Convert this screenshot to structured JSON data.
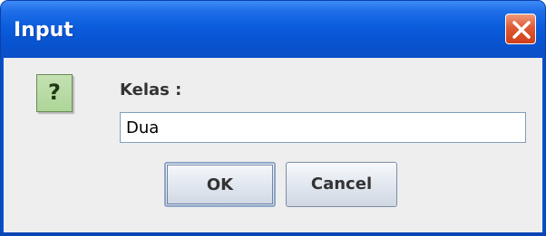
{
  "window": {
    "title": "Input",
    "close_icon": "close-x-icon",
    "accent_color": "#0a5ddc",
    "close_color": "#de5a35"
  },
  "dialog": {
    "icon": "question-icon",
    "icon_glyph": "?",
    "prompt_label": "Kelas :",
    "input_value": "Dua",
    "ok_label": "OK",
    "cancel_label": "Cancel"
  }
}
